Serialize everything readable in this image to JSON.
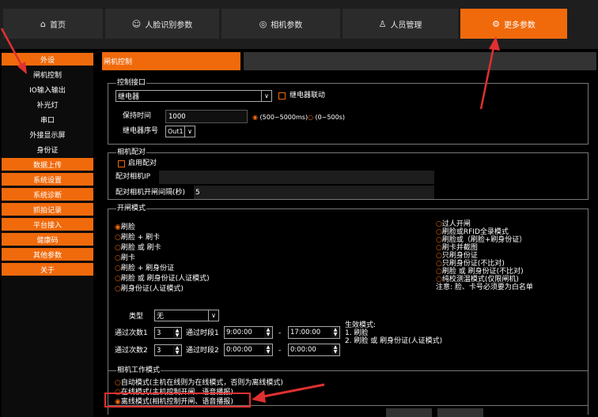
{
  "nav": {
    "tabs": [
      {
        "label": "首页",
        "icon": "⌂"
      },
      {
        "label": "人脸识别参数",
        "icon": "☺"
      },
      {
        "label": "相机参数",
        "icon": "◎"
      },
      {
        "label": "人员管理",
        "icon": "♙"
      },
      {
        "label": "更多参数",
        "icon": "⚙"
      }
    ]
  },
  "sidebar": {
    "items": [
      "外设",
      "闸机控制",
      "IO输入输出",
      "补光灯",
      "串口",
      "外接显示屏",
      "身份证",
      "数据上传",
      "系统设置",
      "系统诊断",
      "抓拍记录",
      "平台接入",
      "健康码",
      "其他参数",
      "关于"
    ]
  },
  "main": {
    "tab_label": "闸机控制"
  },
  "control": {
    "title": "控制接口",
    "interface": "继电器",
    "linkage": "继电器联动",
    "hold_label": "保持时间",
    "hold_value": "1000",
    "range1": "(500~5000ms)",
    "range2": "(0~500s)",
    "relay_no_label": "继电器序号",
    "relay_no": "Out1"
  },
  "pair": {
    "title": "相机配对",
    "enable": "启用配对",
    "ip_label": "配对相机IP",
    "ip_value": "",
    "interval_label": "配对相机开闸间隔(秒)",
    "interval_value": "5"
  },
  "open_mode": {
    "title": "开闸模式",
    "left": [
      "刷脸",
      "刷脸 + 刷卡",
      "刷脸 或 刷卡",
      "刷卡",
      "刷脸 + 刷身份证",
      "刷脸 或 刷身份证(人证模式)",
      "刷身份证(人证模式)"
    ],
    "right": [
      "过人开闸",
      "刷脸或RFID全录模式",
      "刷脸或（刷脸+刷身份证）",
      "刷卡并截图",
      "只刷身份证",
      "只刷身份证(不比对)",
      "刷脸 或 刷身份证(不比对)",
      "纯校测温模式(仅限闸机)"
    ],
    "note": "注意: 脸、卡号必须要为白名单",
    "type_label": "类型",
    "type_value": "无",
    "count1_label": "通过次数1",
    "count1": "3",
    "count2_label": "通过次数2",
    "count2": "3",
    "period1_label": "通过时段1",
    "period1_start": "9:00:00",
    "period1_end": "17:00:00",
    "period2_label": "通过时段2",
    "period2_start": "0:00:00",
    "period2_end": "0:00:00",
    "dash": "-",
    "effect_title": "生效模式:",
    "effect1": "1. 刷脸",
    "effect2": "2. 刷脸 或 刷身份证(人证模式)"
  },
  "work_mode": {
    "title": "相机工作模式",
    "options": [
      "自动模式(主机在线则为在线模式，否则为离线模式)",
      "在线模式(主机控制开闸、语音播报)",
      "离线模式(相机控制开闸、语音播报)"
    ]
  }
}
